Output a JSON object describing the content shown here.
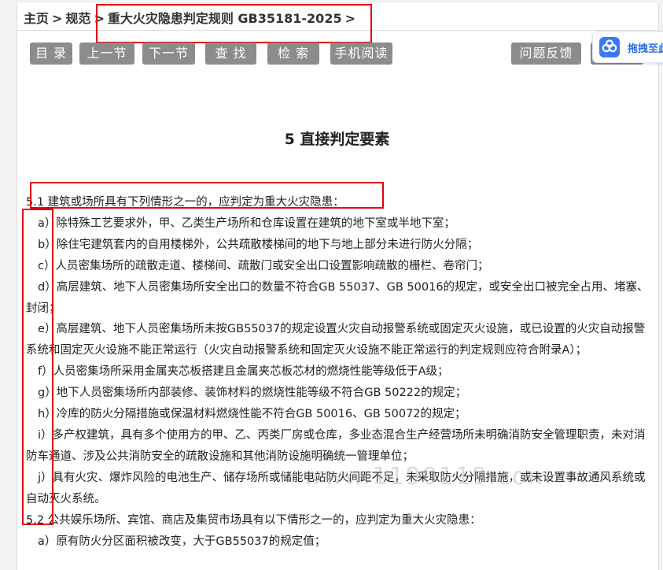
{
  "breadcrumb": {
    "home": "主页",
    "sep": ">",
    "standards": "规范",
    "current": "重大火灾隐患判定规则 GB35181-2025",
    "trailing": ">"
  },
  "toolbar": {
    "toc": "目 录",
    "prev": "上一节",
    "next": "下一节",
    "find": "查 找",
    "search": "检 索",
    "mobile": "手机阅读",
    "feedback": "问题反馈"
  },
  "float_widget": {
    "label": "拖拽至此",
    "icon": "cloud-drive-icon"
  },
  "section_title": "5 直接判定要素",
  "clause_5_1": {
    "heading": "5.1 建筑或场所具有下列情形之一的，应判定为重大火灾隐患：",
    "items": [
      "a）除特殊工艺要求外，甲、乙类生产场所和仓库设置在建筑的地下室或半地下室；",
      "b）除住宅建筑套内的自用楼梯外，公共疏散楼梯间的地下与地上部分未进行防火分隔；",
      "c）人员密集场所的疏散走道、楼梯间、疏散门或安全出口设置影响疏散的栅栏、卷帘门；",
      "d）高层建筑、地下人员密集场所安全出口的数量不符合GB 55037、GB 50016的规定，或安全出口被完全占用、堵塞、封闭；",
      "e）高层建筑、地下人员密集场所未按GB55037的规定设置火灾自动报警系统或固定灭火设施，或已设置的火灾自动报警系统和固定灭火设施不能正常运行（火灾自动报警系统和固定灭火设施不能正常运行的判定规则应符合附录A）；",
      "f）人员密集场所采用金属夹芯板搭建且金属夹芯板芯材的燃烧性能等级低于A级；",
      "g）地下人员密集场所内部装修、装饰材料的燃烧性能等级不符合GB 50222的规定；",
      "h）冷库的防火分隔措施或保温材料燃烧性能不符合GB 50016、GB 50072的规定；",
      "i）多产权建筑，具有多个使用方的甲、乙、丙类厂房或仓库，多业态混合生产经营场所未明确消防安全管理职责，未对消防车通道、涉及公共消防安全的疏散设施和其他消防设施明确统一管理单位；",
      "j）具有火灾、爆炸风险的电池生产、储存场所或储能电站防火间距不足，未采取防火分隔措施，或未设置事故通风系统或自动灭火系统。"
    ]
  },
  "clause_5_2": {
    "heading": "5.2 公共娱乐场所、宾馆、商店及集贸市场具有以下情形之一的，应判定为重大火灾隐患：",
    "first_item": "a）原有防火分区面积被改变，大于GB55037的规定值；"
  },
  "watermark": "www.1190119.com",
  "colors": {
    "toolbar_button": "#8c8c8c",
    "highlight_box": "#e60012",
    "widget_accent": "#3a7af0"
  }
}
